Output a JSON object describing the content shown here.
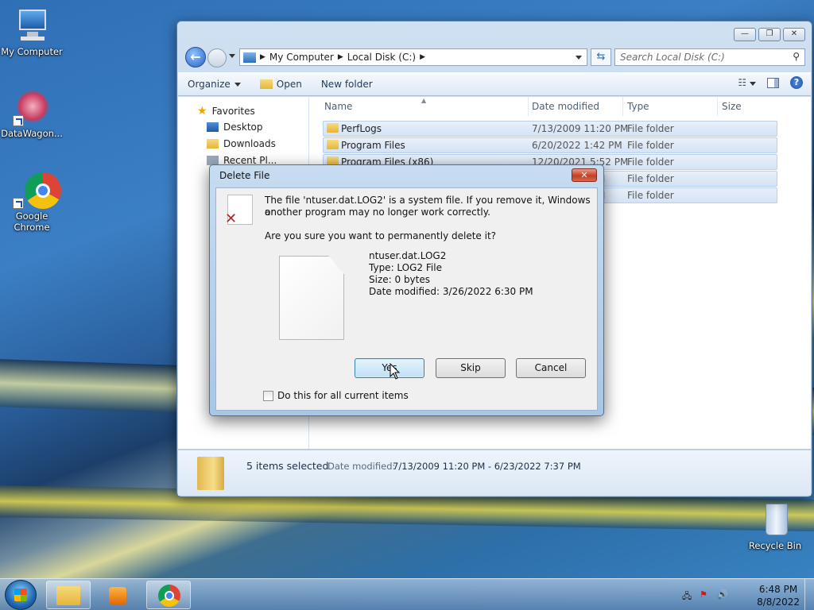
{
  "desktop": {
    "icons": [
      {
        "label": "My Computer"
      },
      {
        "label": "DataWagon..."
      },
      {
        "label": "Google Chrome"
      },
      {
        "label": "Recycle Bin"
      }
    ]
  },
  "explorer": {
    "address": {
      "segments": [
        "My Computer",
        "Local Disk (C:)"
      ]
    },
    "search_placeholder": "Search Local Disk (C:)",
    "toolbar": {
      "organize": "Organize",
      "open": "Open",
      "new_folder": "New folder"
    },
    "navpane": {
      "items": [
        "Favorites",
        "Desktop",
        "Downloads",
        "Recent Pl..."
      ]
    },
    "columns": {
      "name": "Name",
      "date": "Date modified",
      "type": "Type",
      "size": "Size"
    },
    "rows": [
      {
        "name": "PerfLogs",
        "date": "7/13/2009 11:20 PM",
        "type": "File folder"
      },
      {
        "name": "Program Files",
        "date": "6/20/2022 1:42 PM",
        "type": "File folder"
      },
      {
        "name": "Program Files (x86)",
        "date": "12/20/2021 5:52 PM",
        "type": "File folder"
      },
      {
        "name": "",
        "date": "M",
        "type": "File folder"
      },
      {
        "name": "",
        "date": "M",
        "type": "File folder"
      }
    ],
    "details": {
      "selected": "5 items selected",
      "date_label": "Date modified:",
      "date_value": "7/13/2009 11:20 PM - 6/23/2022 7:37 PM"
    }
  },
  "dialog": {
    "title": "Delete File",
    "close": "✕",
    "message_line1": "The file 'ntuser.dat.LOG2' is a system file. If you remove it, Windows or",
    "message_line2": "another program may no longer work correctly.",
    "question": "Are you sure you want to permanently delete it?",
    "file": {
      "name": "ntuser.dat.LOG2",
      "type": "Type: LOG2 File",
      "size": "Size: 0 bytes",
      "modified": "Date modified: 3/26/2022 6:30 PM"
    },
    "buttons": {
      "yes": "Yes",
      "skip": "Skip",
      "cancel": "Cancel"
    },
    "checkbox_label": "Do this for all current items"
  },
  "taskbar": {
    "time": "6:48 PM",
    "date": "8/8/2022"
  }
}
